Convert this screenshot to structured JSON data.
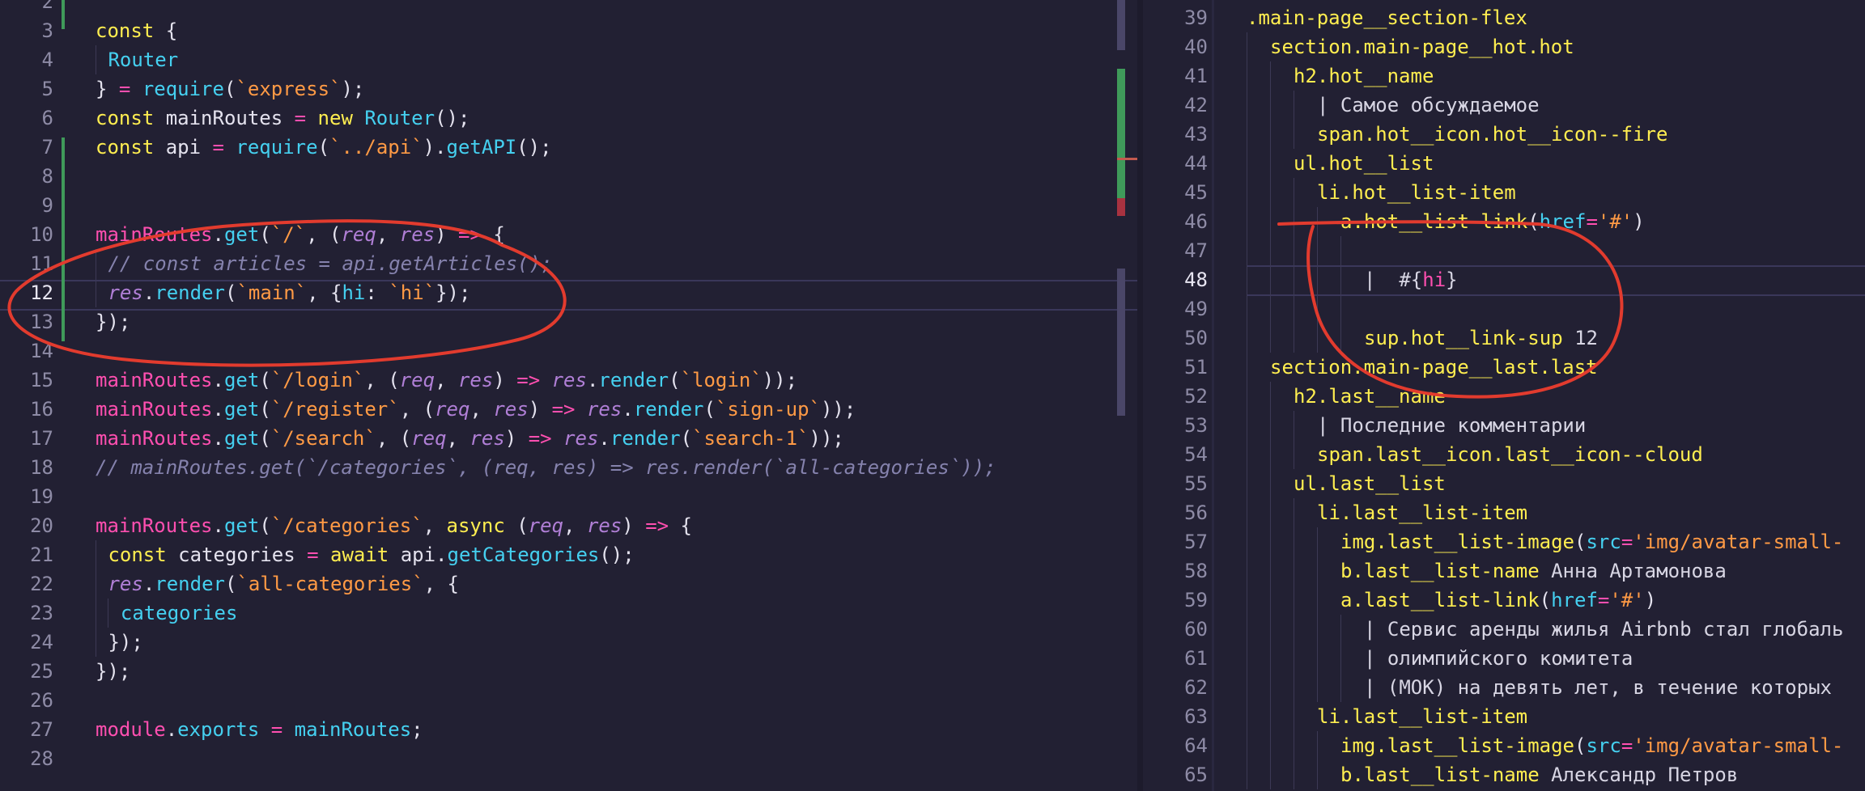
{
  "left_pane": {
    "active_line": "12",
    "lines": [
      {
        "n": "2",
        "parts": []
      },
      {
        "n": "3",
        "parts": [
          [
            "kw",
            "const"
          ],
          [
            "pl",
            " {"
          ]
        ]
      },
      {
        "n": "4",
        "parts": [
          [
            "guide",
            ""
          ],
          [
            "pl",
            " "
          ],
          [
            "fn",
            "Router"
          ]
        ]
      },
      {
        "n": "5",
        "parts": [
          [
            "pl",
            "} "
          ],
          [
            "op",
            "="
          ],
          [
            "pl",
            " "
          ],
          [
            "fn",
            "require"
          ],
          [
            "pl",
            "("
          ],
          [
            "str",
            "`express`"
          ],
          [
            "pl",
            ");"
          ]
        ]
      },
      {
        "n": "6",
        "parts": [
          [
            "kw",
            "const"
          ],
          [
            "pl",
            " mainRoutes "
          ],
          [
            "op",
            "="
          ],
          [
            "pl",
            " "
          ],
          [
            "kw",
            "new"
          ],
          [
            "pl",
            " "
          ],
          [
            "fn",
            "Router"
          ],
          [
            "pl",
            "();"
          ]
        ]
      },
      {
        "n": "7",
        "parts": [
          [
            "kw",
            "const"
          ],
          [
            "pl",
            " api "
          ],
          [
            "op",
            "="
          ],
          [
            "pl",
            " "
          ],
          [
            "fn",
            "require"
          ],
          [
            "pl",
            "("
          ],
          [
            "str",
            "`../api`"
          ],
          [
            "pl",
            ")."
          ],
          [
            "fn",
            "getAPI"
          ],
          [
            "pl",
            "();"
          ]
        ]
      },
      {
        "n": "8",
        "parts": []
      },
      {
        "n": "9",
        "parts": []
      },
      {
        "n": "10",
        "parts": [
          [
            "op",
            "mainRoutes"
          ],
          [
            "pl",
            "."
          ],
          [
            "fn",
            "get"
          ],
          [
            "pl",
            "("
          ],
          [
            "str",
            "`/`"
          ],
          [
            "pl",
            ", ("
          ],
          [
            "param",
            "req"
          ],
          [
            "pl",
            ", "
          ],
          [
            "param",
            "res"
          ],
          [
            "pl",
            ") "
          ],
          [
            "op",
            "=>"
          ],
          [
            "pl",
            " {"
          ]
        ]
      },
      {
        "n": "11",
        "parts": [
          [
            "guide",
            ""
          ],
          [
            "pl",
            " "
          ],
          [
            "cmt",
            "// const articles = api.getArticles();"
          ]
        ]
      },
      {
        "n": "12",
        "parts": [
          [
            "guide",
            ""
          ],
          [
            "pl",
            " "
          ],
          [
            "param",
            "res"
          ],
          [
            "pl",
            "."
          ],
          [
            "fn",
            "render"
          ],
          [
            "pl",
            "("
          ],
          [
            "str",
            "`main`"
          ],
          [
            "pl",
            ", {"
          ],
          [
            "fn",
            "hi"
          ],
          [
            "pl",
            ": "
          ],
          [
            "str",
            "`hi`"
          ],
          [
            "pl",
            "});"
          ]
        ]
      },
      {
        "n": "13",
        "parts": [
          [
            "pl",
            "});"
          ]
        ]
      },
      {
        "n": "14",
        "parts": []
      },
      {
        "n": "15",
        "parts": [
          [
            "op",
            "mainRoutes"
          ],
          [
            "pl",
            "."
          ],
          [
            "fn",
            "get"
          ],
          [
            "pl",
            "("
          ],
          [
            "str",
            "`/login`"
          ],
          [
            "pl",
            ", ("
          ],
          [
            "param",
            "req"
          ],
          [
            "pl",
            ", "
          ],
          [
            "param",
            "res"
          ],
          [
            "pl",
            ") "
          ],
          [
            "op",
            "=>"
          ],
          [
            "pl",
            " "
          ],
          [
            "param",
            "res"
          ],
          [
            "pl",
            "."
          ],
          [
            "fn",
            "render"
          ],
          [
            "pl",
            "("
          ],
          [
            "str",
            "`login`"
          ],
          [
            "pl",
            "));"
          ]
        ]
      },
      {
        "n": "16",
        "parts": [
          [
            "op",
            "mainRoutes"
          ],
          [
            "pl",
            "."
          ],
          [
            "fn",
            "get"
          ],
          [
            "pl",
            "("
          ],
          [
            "str",
            "`/register`"
          ],
          [
            "pl",
            ", ("
          ],
          [
            "param",
            "req"
          ],
          [
            "pl",
            ", "
          ],
          [
            "param",
            "res"
          ],
          [
            "pl",
            ") "
          ],
          [
            "op",
            "=>"
          ],
          [
            "pl",
            " "
          ],
          [
            "param",
            "res"
          ],
          [
            "pl",
            "."
          ],
          [
            "fn",
            "render"
          ],
          [
            "pl",
            "("
          ],
          [
            "str",
            "`sign-up`"
          ],
          [
            "pl",
            "));"
          ]
        ]
      },
      {
        "n": "17",
        "parts": [
          [
            "op",
            "mainRoutes"
          ],
          [
            "pl",
            "."
          ],
          [
            "fn",
            "get"
          ],
          [
            "pl",
            "("
          ],
          [
            "str",
            "`/search`"
          ],
          [
            "pl",
            ", ("
          ],
          [
            "param",
            "req"
          ],
          [
            "pl",
            ", "
          ],
          [
            "param",
            "res"
          ],
          [
            "pl",
            ") "
          ],
          [
            "op",
            "=>"
          ],
          [
            "pl",
            " "
          ],
          [
            "param",
            "res"
          ],
          [
            "pl",
            "."
          ],
          [
            "fn",
            "render"
          ],
          [
            "pl",
            "("
          ],
          [
            "str",
            "`search-1`"
          ],
          [
            "pl",
            "));"
          ]
        ]
      },
      {
        "n": "18",
        "parts": [
          [
            "cmt",
            "// mainRoutes.get(`/categories`, (req, res) => res.render(`all-categories`));"
          ]
        ]
      },
      {
        "n": "19",
        "parts": []
      },
      {
        "n": "20",
        "parts": [
          [
            "op",
            "mainRoutes"
          ],
          [
            "pl",
            "."
          ],
          [
            "fn",
            "get"
          ],
          [
            "pl",
            "("
          ],
          [
            "str",
            "`/categories`"
          ],
          [
            "pl",
            ", "
          ],
          [
            "kw",
            "async"
          ],
          [
            "pl",
            " ("
          ],
          [
            "param",
            "req"
          ],
          [
            "pl",
            ", "
          ],
          [
            "param",
            "res"
          ],
          [
            "pl",
            ") "
          ],
          [
            "op",
            "=>"
          ],
          [
            "pl",
            " {"
          ]
        ]
      },
      {
        "n": "21",
        "parts": [
          [
            "guide",
            ""
          ],
          [
            "pl",
            " "
          ],
          [
            "kw",
            "const"
          ],
          [
            "pl",
            " categories "
          ],
          [
            "op",
            "="
          ],
          [
            "pl",
            " "
          ],
          [
            "kw",
            "await"
          ],
          [
            "pl",
            " api."
          ],
          [
            "fn",
            "getCategories"
          ],
          [
            "pl",
            "();"
          ]
        ]
      },
      {
        "n": "22",
        "parts": [
          [
            "guide",
            ""
          ],
          [
            "pl",
            " "
          ],
          [
            "param",
            "res"
          ],
          [
            "pl",
            "."
          ],
          [
            "fn",
            "render"
          ],
          [
            "pl",
            "("
          ],
          [
            "str",
            "`all-categories`"
          ],
          [
            "pl",
            ", {"
          ]
        ]
      },
      {
        "n": "23",
        "parts": [
          [
            "guide",
            ""
          ],
          [
            "pl",
            " "
          ],
          [
            "guide",
            ""
          ],
          [
            "pl",
            " "
          ],
          [
            "fn",
            "categories"
          ]
        ]
      },
      {
        "n": "24",
        "parts": [
          [
            "guide",
            ""
          ],
          [
            "pl",
            " });"
          ]
        ]
      },
      {
        "n": "25",
        "parts": [
          [
            "pl",
            "});"
          ]
        ]
      },
      {
        "n": "26",
        "parts": []
      },
      {
        "n": "27",
        "parts": [
          [
            "op",
            "module"
          ],
          [
            "pl",
            "."
          ],
          [
            "fn",
            "exports"
          ],
          [
            "pl",
            " "
          ],
          [
            "op",
            "="
          ],
          [
            "pl",
            " "
          ],
          [
            "fn",
            "mainRoutes"
          ],
          [
            "pl",
            ";"
          ]
        ]
      },
      {
        "n": "28",
        "parts": []
      }
    ]
  },
  "right_pane": {
    "active_line": "48",
    "lines": [
      {
        "n": "39",
        "indent": 0,
        "parts": [
          [
            "cls",
            ".main-page__section-flex"
          ]
        ]
      },
      {
        "n": "40",
        "indent": 1,
        "parts": [
          [
            "tag",
            "section"
          ],
          [
            "cls",
            ".main-page__hot.hot"
          ]
        ]
      },
      {
        "n": "41",
        "indent": 2,
        "parts": [
          [
            "tag",
            "h2"
          ],
          [
            "cls",
            ".hot__name"
          ]
        ]
      },
      {
        "n": "42",
        "indent": 3,
        "parts": [
          [
            "txt",
            "| Самое обсуждаемое"
          ]
        ]
      },
      {
        "n": "43",
        "indent": 3,
        "parts": [
          [
            "tag",
            "span"
          ],
          [
            "cls",
            ".hot__icon.hot__icon--fire"
          ]
        ]
      },
      {
        "n": "44",
        "indent": 2,
        "parts": [
          [
            "tag",
            "ul"
          ],
          [
            "cls",
            ".hot__list"
          ]
        ]
      },
      {
        "n": "45",
        "indent": 3,
        "parts": [
          [
            "tag",
            "li"
          ],
          [
            "cls",
            ".hot__list-item"
          ]
        ]
      },
      {
        "n": "46",
        "indent": 4,
        "parts": [
          [
            "tag",
            "a"
          ],
          [
            "cls",
            ".hot__list-link"
          ],
          [
            "pl",
            "("
          ],
          [
            "attr",
            "href"
          ],
          [
            "op",
            "="
          ],
          [
            "str",
            "'#'"
          ],
          [
            "pl",
            ")"
          ]
        ]
      },
      {
        "n": "47",
        "indent": 5,
        "parts": []
      },
      {
        "n": "48",
        "indent": 5,
        "parts": [
          [
            "txt",
            "|  #{"
          ],
          [
            "op",
            "hi"
          ],
          [
            "txt",
            "}"
          ]
        ]
      },
      {
        "n": "49",
        "indent": 5,
        "parts": []
      },
      {
        "n": "50",
        "indent": 5,
        "parts": [
          [
            "tag",
            "sup"
          ],
          [
            "cls",
            ".hot__link-sup"
          ],
          [
            "txt",
            " 12"
          ]
        ]
      },
      {
        "n": "51",
        "indent": 1,
        "parts": [
          [
            "tag",
            "section"
          ],
          [
            "cls",
            ".main-page__last.last"
          ]
        ]
      },
      {
        "n": "52",
        "indent": 2,
        "parts": [
          [
            "tag",
            "h2"
          ],
          [
            "cls",
            ".last__name"
          ]
        ]
      },
      {
        "n": "53",
        "indent": 3,
        "parts": [
          [
            "txt",
            "| Последние комментарии"
          ]
        ]
      },
      {
        "n": "54",
        "indent": 3,
        "parts": [
          [
            "tag",
            "span"
          ],
          [
            "cls",
            ".last__icon.last__icon--cloud"
          ]
        ]
      },
      {
        "n": "55",
        "indent": 2,
        "parts": [
          [
            "tag",
            "ul"
          ],
          [
            "cls",
            ".last__list"
          ]
        ]
      },
      {
        "n": "56",
        "indent": 3,
        "parts": [
          [
            "tag",
            "li"
          ],
          [
            "cls",
            ".last__list-item"
          ]
        ]
      },
      {
        "n": "57",
        "indent": 4,
        "parts": [
          [
            "tag",
            "img"
          ],
          [
            "cls",
            ".last__list-image"
          ],
          [
            "pl",
            "("
          ],
          [
            "attr",
            "src"
          ],
          [
            "op",
            "="
          ],
          [
            "str",
            "'img/avatar-small-"
          ]
        ]
      },
      {
        "n": "58",
        "indent": 4,
        "parts": [
          [
            "tag",
            "b"
          ],
          [
            "cls",
            ".last__list-name"
          ],
          [
            "txt",
            " Анна Артамонова"
          ]
        ]
      },
      {
        "n": "59",
        "indent": 4,
        "parts": [
          [
            "tag",
            "a"
          ],
          [
            "cls",
            ".last__list-link"
          ],
          [
            "pl",
            "("
          ],
          [
            "attr",
            "href"
          ],
          [
            "op",
            "="
          ],
          [
            "str",
            "'#'"
          ],
          [
            "pl",
            ")"
          ]
        ]
      },
      {
        "n": "60",
        "indent": 5,
        "parts": [
          [
            "txt",
            "| Сервис аренды жилья Airbnb стал глобаль"
          ]
        ]
      },
      {
        "n": "61",
        "indent": 5,
        "parts": [
          [
            "txt",
            "| олимпийского комитета"
          ]
        ]
      },
      {
        "n": "62",
        "indent": 5,
        "parts": [
          [
            "txt",
            "| (МОК) на девять лет, в течение которых"
          ]
        ]
      },
      {
        "n": "63",
        "indent": 3,
        "parts": [
          [
            "tag",
            "li"
          ],
          [
            "cls",
            ".last__list-item"
          ]
        ]
      },
      {
        "n": "64",
        "indent": 4,
        "parts": [
          [
            "tag",
            "img"
          ],
          [
            "cls",
            ".last__list-image"
          ],
          [
            "pl",
            "("
          ],
          [
            "attr",
            "src"
          ],
          [
            "op",
            "="
          ],
          [
            "str",
            "'img/avatar-small-"
          ]
        ]
      },
      {
        "n": "65",
        "indent": 4,
        "parts": [
          [
            "tag",
            "b"
          ],
          [
            "cls",
            ".last__list-name"
          ],
          [
            "txt",
            " Александр Петров"
          ]
        ]
      }
    ]
  },
  "colors": {
    "background": "#222033",
    "annotation_red": "#e23b2e",
    "git_added": "#3f9a5a",
    "git_deleted": "#a83240",
    "scrollbar": "#4a4668"
  }
}
